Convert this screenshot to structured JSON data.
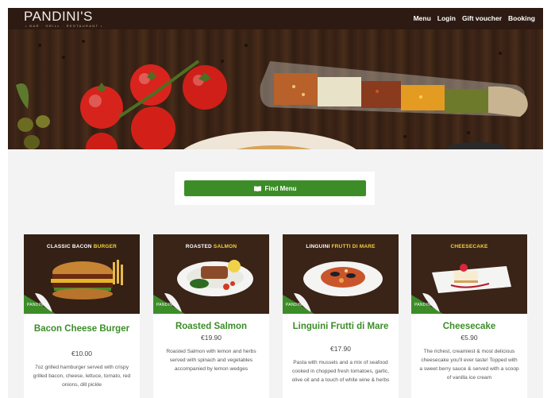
{
  "brand": {
    "name": "PANDINI'S",
    "tagline": "• BAR · GRILL · RESTAURANT •"
  },
  "nav": {
    "items": [
      "Menu",
      "Login",
      "Gift voucher",
      "Booking"
    ]
  },
  "find_menu": {
    "label": "Find Menu",
    "icon": "book-icon"
  },
  "colors": {
    "accent_green": "#3c8d28",
    "header_bg": "#2d1a12",
    "wood": "#3a2316"
  },
  "cards": [
    {
      "banner_pre": "CLASSIC BACON ",
      "banner_hl": "BURGER",
      "title": "Bacon Cheese Burger",
      "price": "€10.00",
      "description": "7oz grilled hamburger served with crispy grilled bacon, cheese, lettuce, tomato, red onions, dill pickle",
      "brand": "PANDINI'S"
    },
    {
      "banner_pre": "ROASTED ",
      "banner_hl": "SALMON",
      "title": "Roasted Salmon",
      "price": "€19.90",
      "description": "Roasted Salmon with lemon and herbs served with spinach and vegetables accompanied by lemon wedges",
      "brand": "PANDINI'S"
    },
    {
      "banner_pre": "LINGUINI ",
      "banner_hl": "FRUTTI DI MARE",
      "title": "Linguini Frutti di Mare",
      "price": "€17.90",
      "description": "Pasta with mussels and a mix of seafood cooked in chopped fresh tomatoes, garlic, olive oil and a touch of white wine & herbs",
      "brand": "PANDINI'S"
    },
    {
      "banner_pre": "",
      "banner_hl": "CHEESECAKE",
      "title": "Cheesecake",
      "price": "€5.90",
      "description": "The richest, creamiest & most delicious cheesecake you'll ever taste! Topped with a sweet berry sauce & served with a scoop of vanilla ice cream",
      "brand": "PANDINI'S"
    }
  ]
}
